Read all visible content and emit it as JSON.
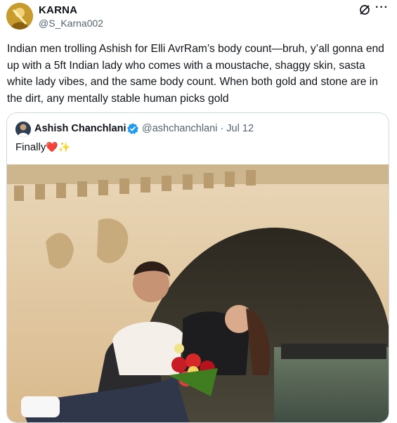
{
  "author": {
    "name": "KARNA",
    "handle": "@S_Karna002",
    "avatar_icon": "avatar-photo"
  },
  "post": {
    "text": "Indian men trolling Ashish for Elli AvrRam’s body count—bruh, y’all gonna end up with a 5ft Indian lady who comes with a moustache, shaggy skin, sasta white lady vibes, and the same body count. When both gold and stone are in the dirt, any mentally stable human picks gold"
  },
  "icons": {
    "grok": "grok-icon",
    "more": "more-icon"
  },
  "more_label": "···",
  "quoted": {
    "name": "Ashish Chanchlani",
    "handle_date": "@ashchanchlani · Jul 12",
    "text": "Finally",
    "emojis": "❤️✨",
    "verified_color": "#1d9bf0"
  },
  "colors": {
    "text": "#0f1419",
    "secondary": "#536471",
    "border": "#cfd9de"
  }
}
